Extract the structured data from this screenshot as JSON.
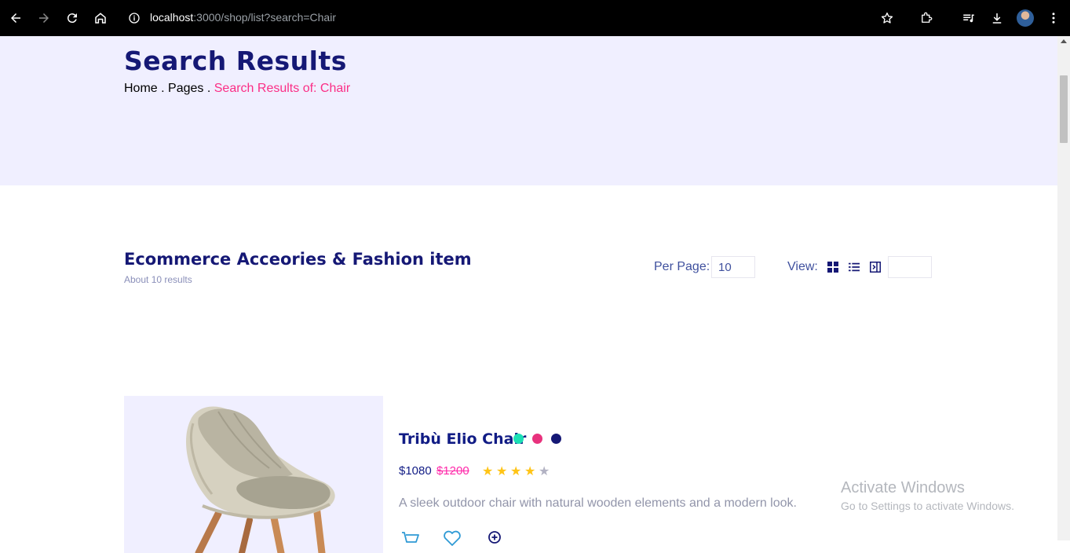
{
  "browser": {
    "url_host": "localhost",
    "url_path": ":3000/shop/list?search=Chair",
    "icons": [
      "back-arrow-icon",
      "forward-arrow-icon",
      "reload-icon",
      "home-icon",
      "site-info-icon",
      "bookmark-star-icon",
      "extensions-icon",
      "media-queue-icon",
      "download-icon",
      "profile-avatar",
      "more-menu-icon"
    ]
  },
  "hero": {
    "title": "Search Results",
    "breadcrumb": {
      "home": "Home",
      "sep1": " . ",
      "pages": "Pages",
      "sep2": " . ",
      "current": "Search Results of: Chair"
    }
  },
  "toolbar": {
    "title": "Ecommerce Acceories & Fashion item",
    "subtitle": "About 10 results",
    "per_page_label": "Per Page:",
    "per_page_value": "10",
    "view_label": "View:",
    "view_input_value": "",
    "view_icons": [
      "grid-view-icon",
      "list-view-icon",
      "sidebar-view-icon"
    ]
  },
  "product": {
    "name": "Tribù Elio Chair",
    "price": "$1080",
    "old_price": "$1200",
    "rating": 4,
    "rating_max": 5,
    "colors": [
      "#1be0b5",
      "#e8327d",
      "#151875"
    ],
    "description": "A sleek outdoor chair with natural wooden elements and a modern look.",
    "actions": [
      "cart-icon",
      "heart-icon",
      "zoom-in-icon"
    ]
  },
  "watermark": {
    "title": "Activate Windows",
    "subtitle": "Go to Settings to activate Windows."
  },
  "colors": {
    "navy": "#151875",
    "pink": "#fb2e86",
    "hero_bg": "#f0efff",
    "star_filled": "#ffc416",
    "star_empty": "#b2b2c3"
  }
}
